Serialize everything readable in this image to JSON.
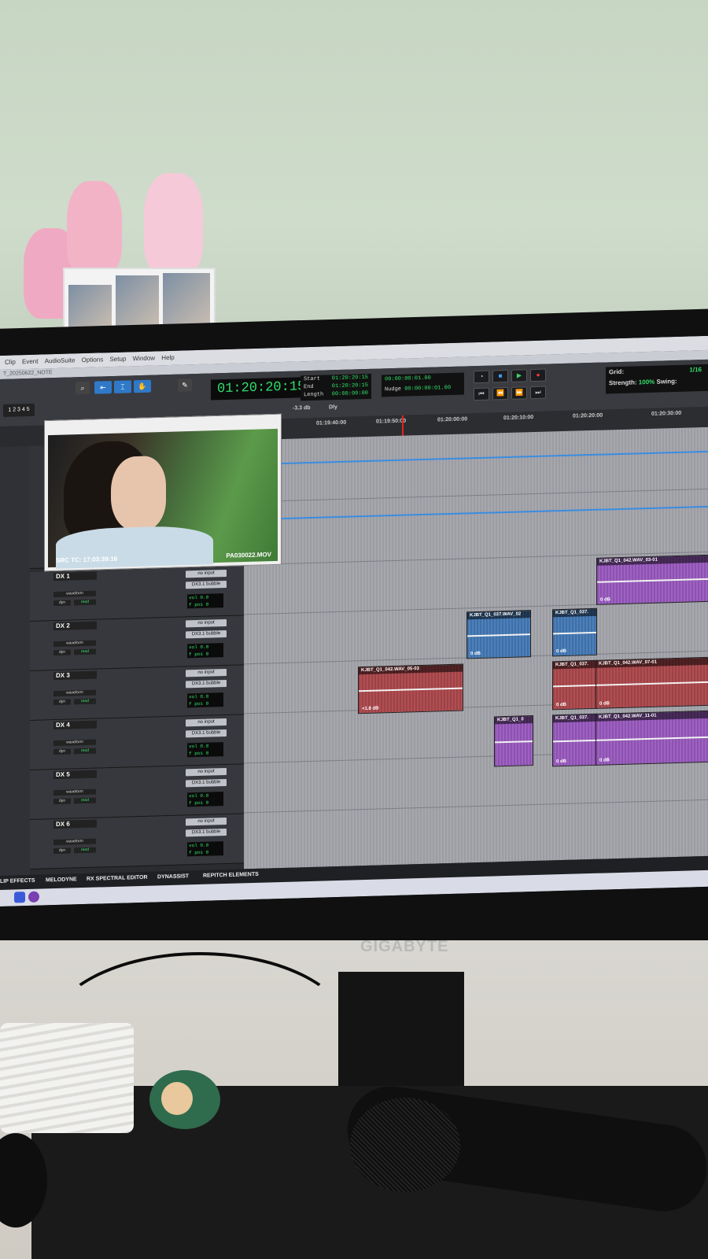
{
  "menu": {
    "items": [
      "Clip",
      "Event",
      "AudioSuite",
      "Options",
      "Setup",
      "Window",
      "Help"
    ],
    "session_title": "T_20250622_NOTE"
  },
  "counter": {
    "main": "01:20:20:15"
  },
  "selection": {
    "start_label": "Start",
    "end_label": "End",
    "length_label": "Length",
    "start": "01:20:20:15",
    "end": "01:20:20:15",
    "length": "00:00:00:00"
  },
  "nudge": {
    "label": "Nudge",
    "value1": "00:00:00:01.00",
    "value2": "00:00:00:01.00"
  },
  "misc": {
    "db_value": "-3.3 db",
    "dly_label": "Dly"
  },
  "grid": {
    "grid_label": "Grid:",
    "grid_value": "1/16",
    "strength_label": "Strength:",
    "strength_value": "100%",
    "swing_label": "Swing:"
  },
  "ruler": {
    "ticks": [
      "01:19:40:00",
      "01:19:50:00",
      "01:20:00:00",
      "01:20:10:00",
      "01:20:20:00",
      "01:20:30:00"
    ]
  },
  "video": {
    "src_tc": "SRC TC: 17:03:39:16",
    "file": "PA030022.MOV"
  },
  "tracks": [
    {
      "name": "DX 1",
      "input": "no input",
      "output": "DX3.1 bubble",
      "mode": "waveform",
      "vol_label": "vol",
      "vol": "0.0",
      "pan_label": "f pos",
      "pan": "0",
      "dyn": "dyn",
      "read": "read"
    },
    {
      "name": "DX 2",
      "input": "no input",
      "output": "DX3.1 bubble",
      "mode": "waveform",
      "vol_label": "vol",
      "vol": "0.0",
      "pan_label": "f pos",
      "pan": "0",
      "dyn": "dyn",
      "read": "read"
    },
    {
      "name": "DX 3",
      "input": "no input",
      "output": "DX3.1 bubble",
      "mode": "waveform",
      "vol_label": "vol",
      "vol": "0.0",
      "pan_label": "f pos",
      "pan": "0",
      "dyn": "dyn",
      "read": "read"
    },
    {
      "name": "DX 4",
      "input": "no input",
      "output": "DX3.1 bubble",
      "mode": "waveform",
      "vol_label": "vol",
      "vol": "0.0",
      "pan_label": "f pos",
      "pan": "0",
      "dyn": "dyn",
      "read": "read"
    },
    {
      "name": "DX 5",
      "input": "no input",
      "output": "DX3.1 bubble",
      "mode": "waveform",
      "vol_label": "vol",
      "vol": "0.0",
      "pan_label": "f pos",
      "pan": "0",
      "dyn": "dyn",
      "read": "read"
    },
    {
      "name": "DX 6",
      "input": "no input",
      "output": "DX3.1 bubble",
      "mode": "waveform",
      "vol_label": "vol",
      "vol": "0.0",
      "pan_label": "f pos",
      "pan": "0",
      "dyn": "dyn",
      "read": "read"
    }
  ],
  "clips": [
    {
      "name": "KJBT_Q1_042.WAV_03-01",
      "gain": "0 dB",
      "color": "#9e62c2"
    },
    {
      "name": "KJBT_Q1_037.WAV_02",
      "gain": "0 dB",
      "color": "#4d80ba"
    },
    {
      "name": "KJBT_Q1_037.",
      "gain": "0 dB",
      "color": "#4d80ba"
    },
    {
      "name": "KJBT_Q1_042.WAV_05-03",
      "gain": "+1.8 dB",
      "color": "#b04f53"
    },
    {
      "name": "KJBT_Q1_037.",
      "gain": "0 dB",
      "color": "#b04f53"
    },
    {
      "name": "KJBT_Q1_042.WAV_07-01",
      "gain": "0 dB",
      "color": "#b04f53"
    },
    {
      "name": "KJBT_Q1_0",
      "gain": "",
      "color": "#9e62c2"
    },
    {
      "name": "KJBT_Q1_037.",
      "gain": "0 dB",
      "color": "#9e62c2"
    },
    {
      "name": "KJBT_Q1_042.WAV_11-01",
      "gain": "0 dB",
      "color": "#9e62c2"
    }
  ],
  "bottom_tabs": [
    "LIP EFFECTS",
    "MELODYNE",
    "RX SPECTRAL EDITOR",
    "DYNASSIST",
    "REPITCH ELEMENTS"
  ],
  "monitor_brand": "GIGABYTE",
  "icons": [
    "play-icon",
    "stop-icon",
    "record-icon",
    "rewind-icon",
    "fast-forward-icon",
    "zoom-icon",
    "hand-icon",
    "pencil-icon"
  ]
}
